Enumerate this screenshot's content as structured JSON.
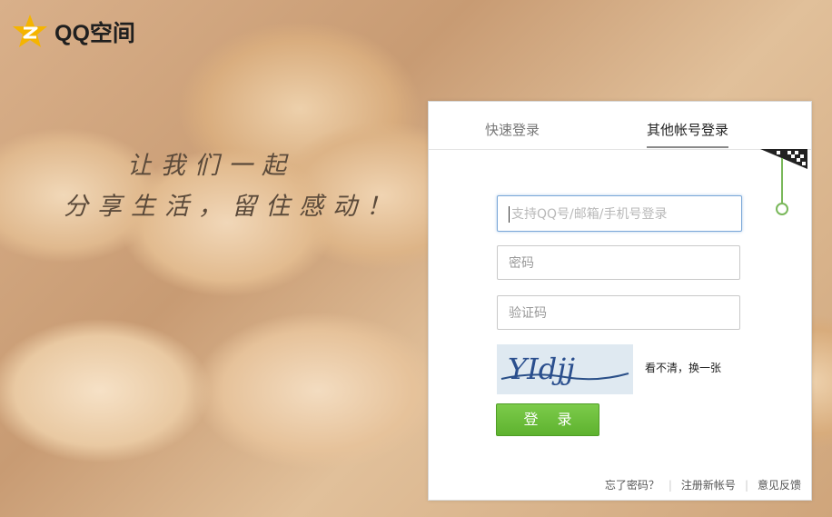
{
  "brand": {
    "name": "QQ空间"
  },
  "slogan": {
    "line1": "让我们一起",
    "line2": "分享生活，留住感动！"
  },
  "login_panel": {
    "tabs": [
      {
        "label": "快速登录",
        "active": false
      },
      {
        "label": "其他帐号登录",
        "active": true
      }
    ],
    "account_field": {
      "value": "",
      "placeholder": "支持QQ号/邮箱/手机号登录"
    },
    "password_field": {
      "value": "",
      "placeholder": "密码"
    },
    "captcha_field": {
      "value": "",
      "placeholder": "验证码"
    },
    "captcha_image_text": "YIdjj",
    "refresh_captcha_label": "看不清，换一张",
    "login_button_label": "登 录",
    "footer_links": {
      "forgot_password": "忘了密码？",
      "register": "注册新帐号",
      "feedback": "意见反馈"
    }
  },
  "colors": {
    "login_button": "#6cbf3c",
    "focus_border": "#7aa7d8",
    "logo_star": "#f5b400",
    "qr_toggle_accent": "#7ab85b"
  },
  "icons": {
    "logo": "qzone-star-logo",
    "qr": "qr-code-corner-icon"
  }
}
